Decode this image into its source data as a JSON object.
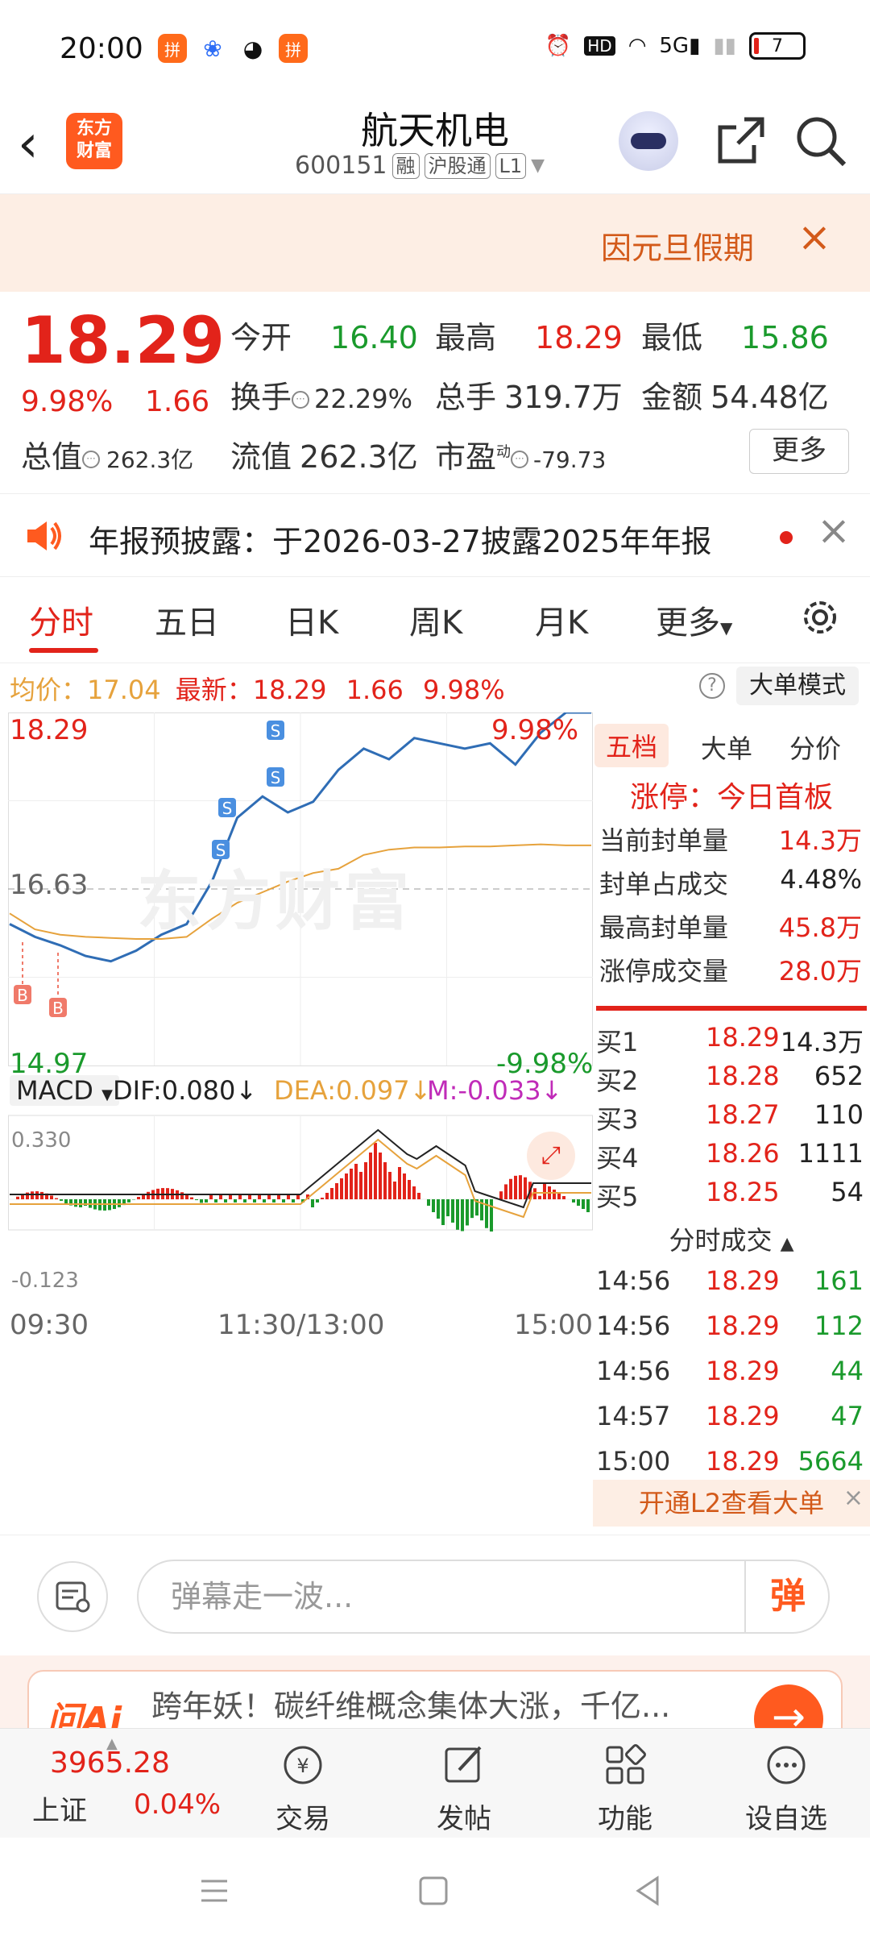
{
  "status": {
    "time": "20:00",
    "battery": "7"
  },
  "header": {
    "logo_line1": "东方",
    "logo_line2": "财富",
    "stock_name": "航天机电",
    "code": "600151",
    "tags": [
      "融",
      "沪股通",
      "L1"
    ]
  },
  "notice": {
    "text": "因元旦假期"
  },
  "quote": {
    "price": "18.29",
    "change_pct": "9.98%",
    "change": "1.66",
    "open_label": "今开",
    "open": "16.40",
    "high_label": "最高",
    "high": "18.29",
    "low_label": "最低",
    "low": "15.86",
    "turnover_label": "换手",
    "turnover": "22.29%",
    "volume_label": "总手",
    "volume": "319.7万",
    "amount_label": "金额",
    "amount": "54.48亿",
    "mktcap_label": "总值",
    "mktcap": "262.3亿",
    "float_label": "流值",
    "float": "262.3亿",
    "pe_label": "市盈",
    "pe_sup": "动",
    "pe": "-79.73",
    "more": "更多"
  },
  "announce": {
    "text": "年报预披露：于2026-03-27披露2025年年报"
  },
  "tabs": [
    "分时",
    "五日",
    "日K",
    "周K",
    "月K",
    "更多"
  ],
  "avgrow": {
    "avg_label": "均价：",
    "avg": "17.04",
    "latest_label": "最新：",
    "latest": "18.29",
    "chg": "1.66",
    "pct": "9.98%",
    "mode": "大单模式"
  },
  "chart": {
    "top_price": "18.29",
    "top_pct": "9.98%",
    "mid_price": "16.63",
    "bottom_price": "14.97",
    "bottom_pct": "-9.98%",
    "macd_select": "MACD",
    "dif": "DIF:0.080",
    "dea": "DEA:0.097",
    "m": "M:-0.033",
    "macd_top": "0.330",
    "macd_bottom": "-0.123",
    "time_start": "09:30",
    "time_mid": "11:30/13:00",
    "time_end": "15:00",
    "markers": [
      "B",
      "B",
      "S",
      "S",
      "S",
      "S"
    ],
    "watermark": "东方财富"
  },
  "chart_data": {
    "type": "line",
    "title": "",
    "xlabel": "",
    "ylabel": "",
    "ylim": [
      14.97,
      18.29
    ],
    "x": [
      "09:30",
      "11:30/13:00",
      "15:00"
    ],
    "series": [
      {
        "name": "",
        "color": "#2f6db5",
        "values": [
          16.3,
          16.18,
          16.1,
          16.0,
          15.95,
          16.05,
          16.2,
          16.3,
          16.7,
          17.3,
          17.5,
          17.35,
          17.45,
          17.75,
          17.95,
          17.85,
          18.05,
          18.0,
          17.95,
          18.0,
          17.8,
          18.1,
          18.29,
          18.29
        ]
      },
      {
        "name": "",
        "color": "#e6a23c",
        "values": [
          16.4,
          16.25,
          16.2,
          16.18,
          16.17,
          16.16,
          16.16,
          16.18,
          16.35,
          16.5,
          16.6,
          16.7,
          16.78,
          16.82,
          16.95,
          17.0,
          17.02,
          17.02,
          17.03,
          17.03,
          17.04,
          17.05,
          17.04,
          17.04
        ]
      }
    ]
  },
  "right_panel": {
    "tabs": [
      "五档",
      "大单",
      "分价"
    ],
    "limit_title": "涨停：今日首板",
    "seal": [
      {
        "label": "当前封单量",
        "value": "14.3万"
      },
      {
        "label": "封单占成交",
        "value": "4.48%"
      },
      {
        "label": "最高封单量",
        "value": "45.8万"
      },
      {
        "label": "涨停成交量",
        "value": "28.0万"
      }
    ],
    "book": [
      {
        "label": "买1",
        "price": "18.29",
        "vol": "14.3万"
      },
      {
        "label": "买2",
        "price": "18.28",
        "vol": "652"
      },
      {
        "label": "买3",
        "price": "18.27",
        "vol": "110"
      },
      {
        "label": "买4",
        "price": "18.26",
        "vol": "1111"
      },
      {
        "label": "买5",
        "price": "18.25",
        "vol": "54"
      }
    ],
    "ticks_title": "分时成交",
    "ticks": [
      {
        "time": "14:56",
        "price": "18.29",
        "vol": "161"
      },
      {
        "time": "14:56",
        "price": "18.29",
        "vol": "112"
      },
      {
        "time": "14:56",
        "price": "18.29",
        "vol": "44"
      },
      {
        "time": "14:57",
        "price": "18.29",
        "vol": "47"
      },
      {
        "time": "15:00",
        "price": "18.29",
        "vol": "5664"
      }
    ],
    "l2": "开通L2查看大单"
  },
  "danmu": {
    "placeholder": "弹幕走一波...",
    "button": "弹"
  },
  "ai": {
    "brand": "问Ai",
    "text": "跨年妖！碳纤维概念集体大涨，千亿..."
  },
  "bottom": {
    "index_value": "3965.28",
    "index_name": "上证",
    "index_pct": "0.04%",
    "items": [
      "交易",
      "发帖",
      "功能",
      "设自选"
    ]
  }
}
